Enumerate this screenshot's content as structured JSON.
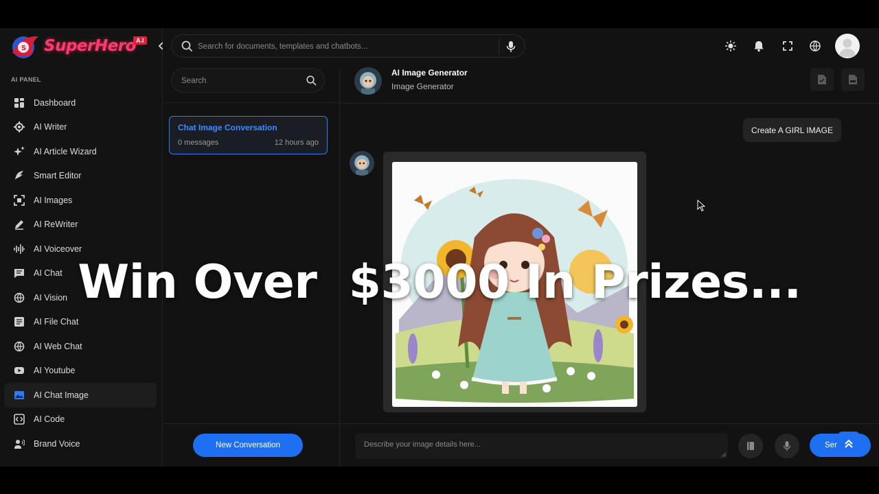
{
  "brand": {
    "name": "SuperHero",
    "badge": "A.I"
  },
  "sidebar": {
    "section_label": "AI PANEL",
    "items": [
      {
        "label": "Dashboard",
        "icon": "dashboard-icon"
      },
      {
        "label": "AI Writer",
        "icon": "writer-icon"
      },
      {
        "label": "AI Article Wizard",
        "icon": "sparkle-icon"
      },
      {
        "label": "Smart Editor",
        "icon": "feather-icon"
      },
      {
        "label": "AI Images",
        "icon": "image-scan-icon"
      },
      {
        "label": "AI ReWriter",
        "icon": "pencil-icon"
      },
      {
        "label": "AI Voiceover",
        "icon": "waveform-icon"
      },
      {
        "label": "AI Chat",
        "icon": "chat-icon"
      },
      {
        "label": "AI Vision",
        "icon": "vision-icon"
      },
      {
        "label": "AI File Chat",
        "icon": "file-chat-icon"
      },
      {
        "label": "AI Web Chat",
        "icon": "globe-icon"
      },
      {
        "label": "AI Youtube",
        "icon": "youtube-icon"
      },
      {
        "label": "AI Chat Image",
        "icon": "chat-image-icon",
        "active": true
      },
      {
        "label": "AI Code",
        "icon": "code-icon"
      },
      {
        "label": "Brand Voice",
        "icon": "brand-voice-icon"
      }
    ]
  },
  "topbar": {
    "search_placeholder": "Search for documents, templates and chatbots...",
    "icons": [
      "sun-icon",
      "bell-icon",
      "fullscreen-icon",
      "globe-icon",
      "user-avatar"
    ]
  },
  "conversations": {
    "search_placeholder": "Search",
    "items": [
      {
        "title": "Chat Image Conversation",
        "count": "0 messages",
        "time": "12 hours ago"
      }
    ],
    "new_button": "New Conversation"
  },
  "chat": {
    "bot_name": "AI Image Generator",
    "bot_subtitle": "Image Generator",
    "user_message": "Create A GIRL IMAGE",
    "prompt_placeholder": "Describe your image details here...",
    "send_label": "Send"
  },
  "overlay": {
    "text": "Win Over  $3000 In Prizes..."
  },
  "colors": {
    "accent": "#1f6ff2",
    "active_text": "#3d8bff",
    "brand": "#ff3b6b"
  }
}
